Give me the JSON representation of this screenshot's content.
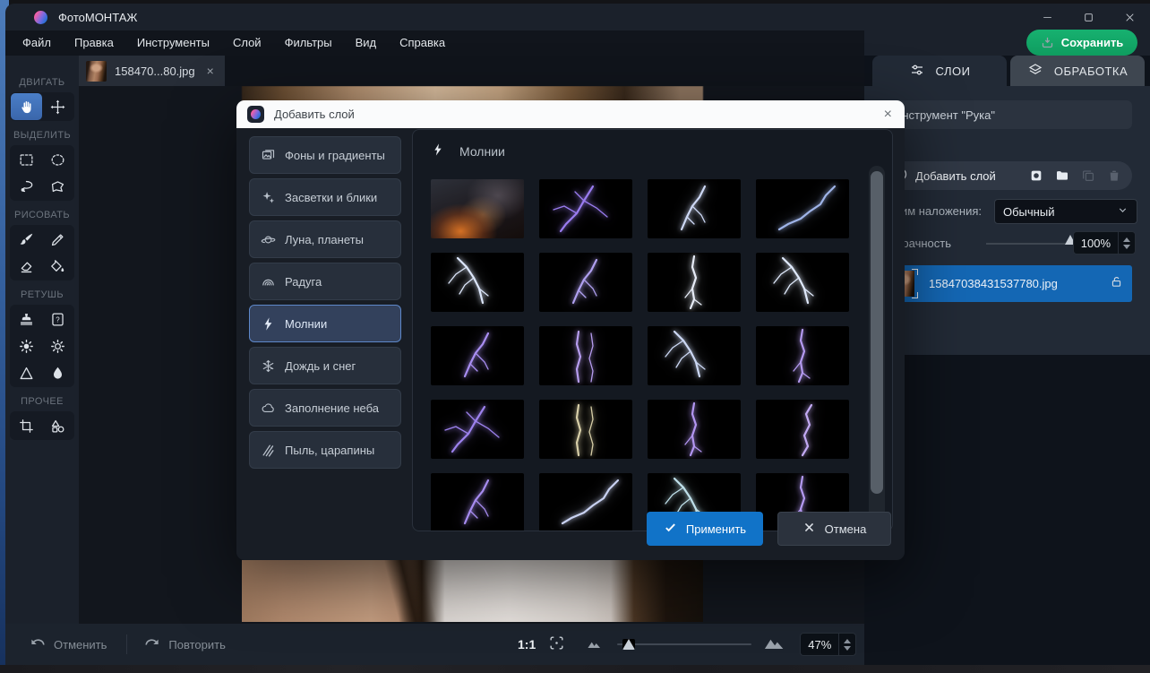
{
  "window": {
    "title": "ФотоМОНТАЖ",
    "controls": [
      "minimize-icon",
      "maximize-icon",
      "close-icon"
    ]
  },
  "menu": {
    "items": [
      {
        "label": "Файл"
      },
      {
        "label": "Правка"
      },
      {
        "label": "Инструменты"
      },
      {
        "label": "Слой"
      },
      {
        "label": "Фильтры"
      },
      {
        "label": "Вид"
      },
      {
        "label": "Справка"
      }
    ]
  },
  "toolbar": {
    "sections": [
      {
        "label": "ДВИГАТЬ",
        "tools": [
          {
            "icon": "hand-icon",
            "selected": true
          },
          {
            "icon": "move-icon",
            "selected": false
          }
        ]
      },
      {
        "label": "ВЫДЕЛИТЬ",
        "tools": [
          {
            "icon": "rect-select-icon"
          },
          {
            "icon": "ellipse-select-icon"
          },
          {
            "icon": "lasso-icon"
          },
          {
            "icon": "polygon-lasso-icon"
          }
        ]
      },
      {
        "label": "РИСОВАТЬ",
        "tools": [
          {
            "icon": "brush-icon"
          },
          {
            "icon": "pencil-icon"
          },
          {
            "icon": "eraser-icon"
          },
          {
            "icon": "fill-icon"
          }
        ]
      },
      {
        "label": "РЕТУШЬ",
        "tools": [
          {
            "icon": "stamp-icon"
          },
          {
            "icon": "patch-icon"
          },
          {
            "icon": "dodge-icon"
          },
          {
            "icon": "burn-icon"
          },
          {
            "icon": "sharpen-icon"
          },
          {
            "icon": "blur-icon"
          }
        ]
      },
      {
        "label": "ПРОЧЕЕ",
        "tools": [
          {
            "icon": "crop-icon"
          },
          {
            "icon": "shapes-icon"
          }
        ]
      }
    ]
  },
  "document_tab": {
    "label": "158470...80.jpg",
    "close": "×"
  },
  "save_button": {
    "label": "Сохранить",
    "icon": "save-download-icon",
    "color": "#12a667"
  },
  "right_panel": {
    "tabs": [
      {
        "label": "СЛОИ",
        "icon": "sliders-icon",
        "active": true
      },
      {
        "label": "ОБРАБОТКА",
        "icon": "layers-stack-icon",
        "active": false
      }
    ],
    "tool_info": "Инструмент \"Рука\"",
    "add_layer": {
      "label": "Добавить слой",
      "icon": "plus-circle-icon",
      "actions": [
        {
          "icon": "mask-layer-icon",
          "tone": "bright"
        },
        {
          "icon": "folder-icon",
          "tone": "bright"
        },
        {
          "icon": "duplicate-icon",
          "tone": "dim"
        },
        {
          "icon": "trash-icon",
          "tone": "dim"
        }
      ]
    },
    "blend": {
      "label": "Режим наложения:",
      "value": "Обычный"
    },
    "opacity": {
      "label": "Прозрачность",
      "value": "100%"
    },
    "layer": {
      "filename": "15847038431537780.jpg",
      "selected": true,
      "lock_icon": "lock-open-icon",
      "selected_color": "#1467b4"
    }
  },
  "dialog": {
    "title": "Добавить слой",
    "close": "×",
    "categories": [
      {
        "label": "Фоны и градиенты",
        "icon": "backgrounds-icon",
        "selected": false
      },
      {
        "label": "Засветки и блики",
        "icon": "sparkles-icon",
        "selected": false
      },
      {
        "label": "Луна, планеты",
        "icon": "planet-icon",
        "selected": false
      },
      {
        "label": "Радуга",
        "icon": "rainbow-icon",
        "selected": false
      },
      {
        "label": "Молнии",
        "icon": "lightning-icon",
        "selected": true
      },
      {
        "label": "Дождь и снег",
        "icon": "snowflake-icon",
        "selected": false
      },
      {
        "label": "Заполнение неба",
        "icon": "cloud-icon",
        "selected": false
      },
      {
        "label": "Пыль, царапины",
        "icon": "scratches-icon",
        "selected": false
      }
    ],
    "content_title": "Молнии",
    "content_icon": "lightning-icon",
    "thumbnails": [
      {
        "name": "storm-clouds-orange",
        "variant": "storm"
      },
      {
        "name": "lightning-purple-branched",
        "variant": "bolt",
        "shape": 1,
        "color": "#9a7cf0"
      },
      {
        "name": "lightning-blue-diagonal",
        "variant": "bolt",
        "shape": 2,
        "color": "#cdd8f5"
      },
      {
        "name": "lightning-thin-blue",
        "variant": "bolt",
        "shape": 3,
        "color": "#9fb4e8"
      },
      {
        "name": "lightning-white-spread",
        "variant": "bolt",
        "shape": 4,
        "color": "#dce6fa"
      },
      {
        "name": "lightning-violet-diagonal",
        "variant": "bolt",
        "shape": 2,
        "color": "#b0a0f0"
      },
      {
        "name": "lightning-vertical-white",
        "variant": "bolt",
        "shape": 5,
        "color": "#e8edf8"
      },
      {
        "name": "lightning-bright-branched",
        "variant": "bolt",
        "shape": 4,
        "color": "#e0eafc"
      },
      {
        "name": "lightning-purple-diagonal",
        "variant": "bolt",
        "shape": 2,
        "color": "#a98ef2"
      },
      {
        "name": "lightning-purple-double",
        "variant": "bolt",
        "shape": 6,
        "color": "#b79df0"
      },
      {
        "name": "lightning-blue-branch",
        "variant": "bolt",
        "shape": 4,
        "color": "#ccd8f4"
      },
      {
        "name": "lightning-violet-vertical",
        "variant": "bolt",
        "shape": 5,
        "color": "#b49af0"
      },
      {
        "name": "lightning-purple-dense",
        "variant": "bolt",
        "shape": 1,
        "color": "#9d82ee"
      },
      {
        "name": "lightning-gold-thin",
        "variant": "bolt",
        "shape": 6,
        "color": "#d8cfa8"
      },
      {
        "name": "lightning-violet-bolt",
        "variant": "bolt",
        "shape": 5,
        "color": "#b396f2"
      },
      {
        "name": "lightning-purple-curve",
        "variant": "bolt",
        "shape": 7,
        "color": "#c3aaf4"
      },
      {
        "name": "lightning-purple-row5a",
        "variant": "bolt",
        "shape": 2,
        "color": "#a78cf0"
      },
      {
        "name": "lightning-blue-row5b",
        "variant": "bolt",
        "shape": 3,
        "color": "#c9d2f2"
      },
      {
        "name": "lightning-cyan-row5c",
        "variant": "bolt",
        "shape": 4,
        "color": "#bfe0ea"
      },
      {
        "name": "lightning-violet-row5d",
        "variant": "bolt",
        "shape": 5,
        "color": "#b49af2"
      }
    ],
    "apply_label": "Применить",
    "cancel_label": "Отмена",
    "apply_color": "#1173c8"
  },
  "status_bar": {
    "undo_label": "Отменить",
    "redo_label": "Повторить",
    "zoom_ratio": "1:1",
    "zoom_value": "47%"
  }
}
